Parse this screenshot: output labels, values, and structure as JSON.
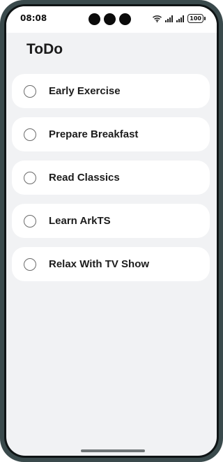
{
  "status_bar": {
    "time": "08:08",
    "battery": "100",
    "icons": [
      "wifi-icon",
      "signal-icon",
      "signal-icon",
      "battery-icon"
    ]
  },
  "header": {
    "title": "ToDo"
  },
  "todos": [
    {
      "label": "Early Exercise",
      "checked": false
    },
    {
      "label": "Prepare Breakfast",
      "checked": false
    },
    {
      "label": "Read Classics",
      "checked": false
    },
    {
      "label": "Learn ArkTS",
      "checked": false
    },
    {
      "label": "Relax With TV Show",
      "checked": false
    }
  ],
  "colors": {
    "background": "#f1f2f4",
    "card": "#ffffff",
    "frame": "#3a4a4c"
  }
}
